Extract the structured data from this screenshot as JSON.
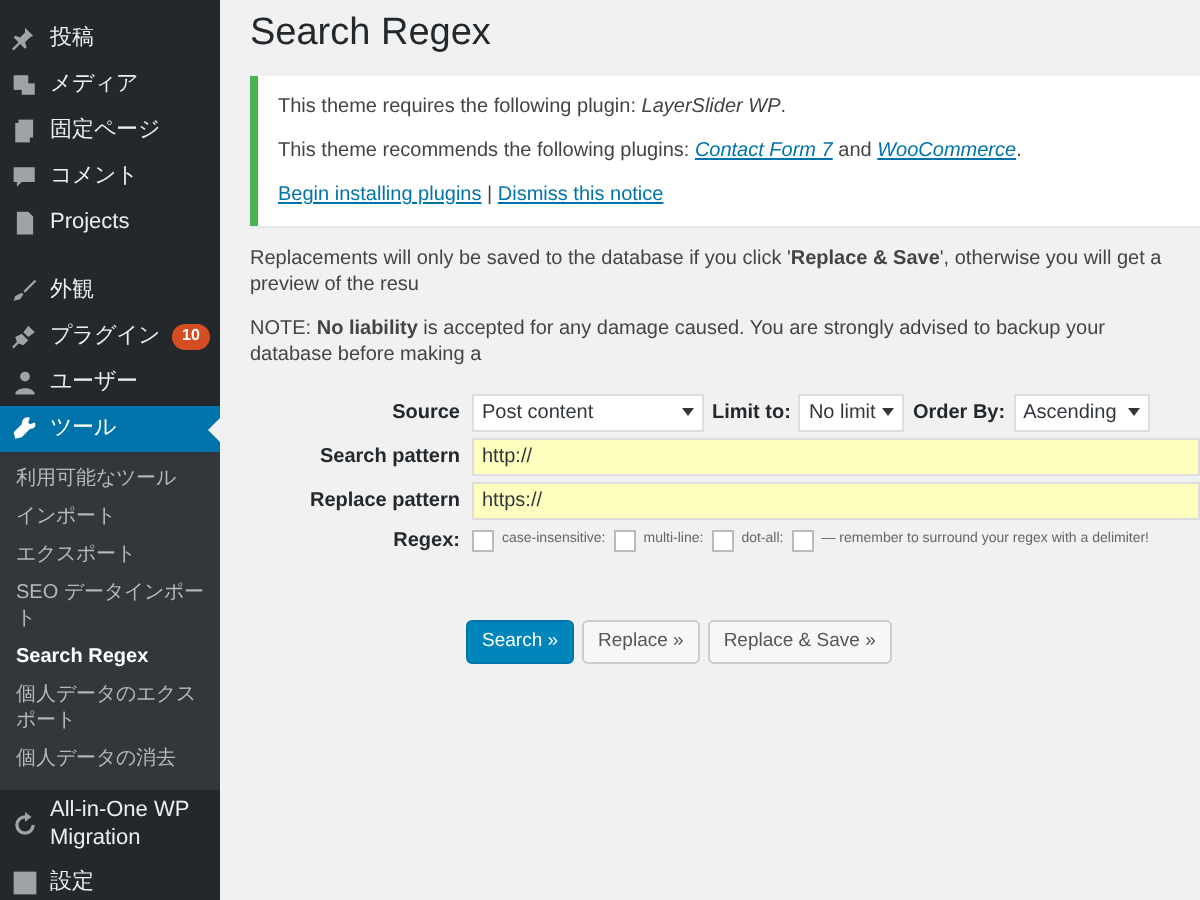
{
  "sidebar": {
    "items": [
      {
        "label": "投稿",
        "selected": false
      },
      {
        "label": "メディア",
        "selected": false
      },
      {
        "label": "固定ページ",
        "selected": false
      },
      {
        "label": "コメント",
        "selected": false
      },
      {
        "label": "Projects",
        "selected": false
      },
      {
        "label": "外観",
        "selected": false
      },
      {
        "label": "プラグイン",
        "selected": false,
        "badge": "10"
      },
      {
        "label": "ユーザー",
        "selected": false
      },
      {
        "label": "ツール",
        "selected": true,
        "children": [
          {
            "label": "利用可能なツール",
            "selected": false
          },
          {
            "label": "インポート",
            "selected": false
          },
          {
            "label": "エクスポート",
            "selected": false
          },
          {
            "label": "SEO データインポート",
            "selected": false
          },
          {
            "label": "Search Regex",
            "selected": true
          },
          {
            "label": "個人データのエクスポート",
            "selected": false
          },
          {
            "label": "個人データの消去",
            "selected": false
          }
        ]
      },
      {
        "label": "All-in-One WP Migration",
        "selected": false
      },
      {
        "label": "設定",
        "selected": false
      }
    ]
  },
  "page_title": "Search Regex",
  "notice": {
    "required": "This theme requires the following plugin: *LayerSlider WP*.",
    "recommended": {
      "text": "This theme recommends the following plugins:",
      "links": [
        "Contact Form 7",
        "WooCommerce"
      ],
      "joiner": "and",
      "end": "."
    },
    "actions": [
      "Begin installing plugins",
      "Dismiss this notice"
    ],
    "separator": "|"
  },
  "info": [
    "Replacements will only be saved to the database if you click '**Replace & Save**', otherwise you will get a preview of the resu",
    "NOTE: **No liability** is accepted for any damage caused. You are strongly advised to backup your database before making a"
  ],
  "form": {
    "source": {
      "label": "Source",
      "value": "Post content"
    },
    "limit": {
      "label": "Limit to:",
      "value": "No limit"
    },
    "order": {
      "label": "Order By:",
      "value": "Ascending"
    },
    "search_pattern": {
      "label": "Search pattern",
      "value": "http://"
    },
    "replace_pattern": {
      "label": "Replace pattern",
      "value": "https://"
    },
    "regex": {
      "label": "Regex:",
      "checked": false
    },
    "options": [
      {
        "label": "case-insensitive:",
        "checked": false
      },
      {
        "label": "multi-line:",
        "checked": false
      },
      {
        "label": "dot-all:",
        "checked": false
      }
    ],
    "hint": "— remember to surround your regex with a delimiter!"
  },
  "buttons": [
    {
      "label": "Search »",
      "primary": true
    },
    {
      "label": "Replace »",
      "primary": false
    },
    {
      "label": "Replace & Save »",
      "primary": false
    }
  ]
}
